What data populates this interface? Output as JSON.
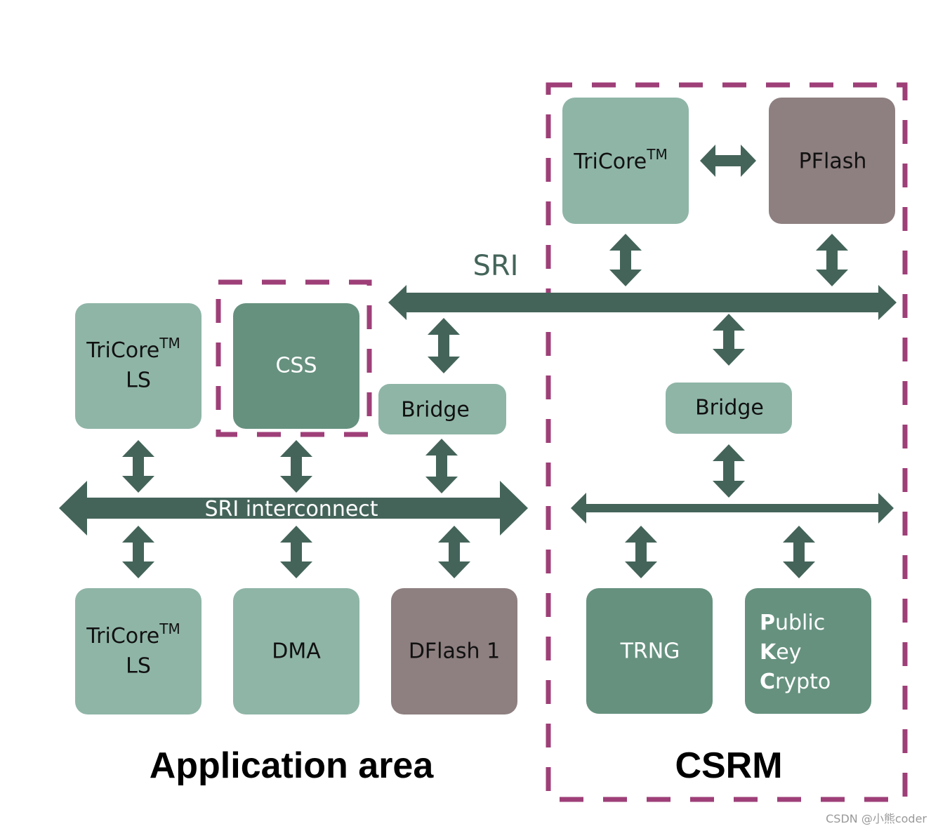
{
  "colors": {
    "light_block": "#8fb5a7",
    "mid_block": "#66917f",
    "memory_block": "#8e7f80",
    "arrow": "#44645a",
    "dashed_border": "#9e3f78"
  },
  "blocks": {
    "tricore_csrm": {
      "label": "TriCore",
      "sup": "TM"
    },
    "pflash": {
      "label": "PFlash"
    },
    "tricore_ls_top": {
      "label": "TriCore",
      "sup": "TM",
      "line2": "LS"
    },
    "css": {
      "label": "CSS"
    },
    "bridge_left": {
      "label": "Bridge"
    },
    "bridge_right": {
      "label": "Bridge"
    },
    "tricore_ls_bottom": {
      "label": "TriCore",
      "sup": "TM",
      "line2": "LS"
    },
    "dma": {
      "label": "DMA"
    },
    "dflash": {
      "label": "DFlash 1"
    },
    "trng": {
      "label": "TRNG"
    },
    "pkc": {
      "lines": [
        {
          "initial": "P",
          "rest": "ublic"
        },
        {
          "initial": "K",
          "rest": "ey"
        },
        {
          "initial": "C",
          "rest": "rypto"
        }
      ]
    }
  },
  "buses": {
    "sri": "SRI",
    "sri_interconnect": "SRI interconnect"
  },
  "areas": {
    "application": "Application area",
    "csrm": "CSRM"
  },
  "watermark": "CSDN @小熊coder"
}
